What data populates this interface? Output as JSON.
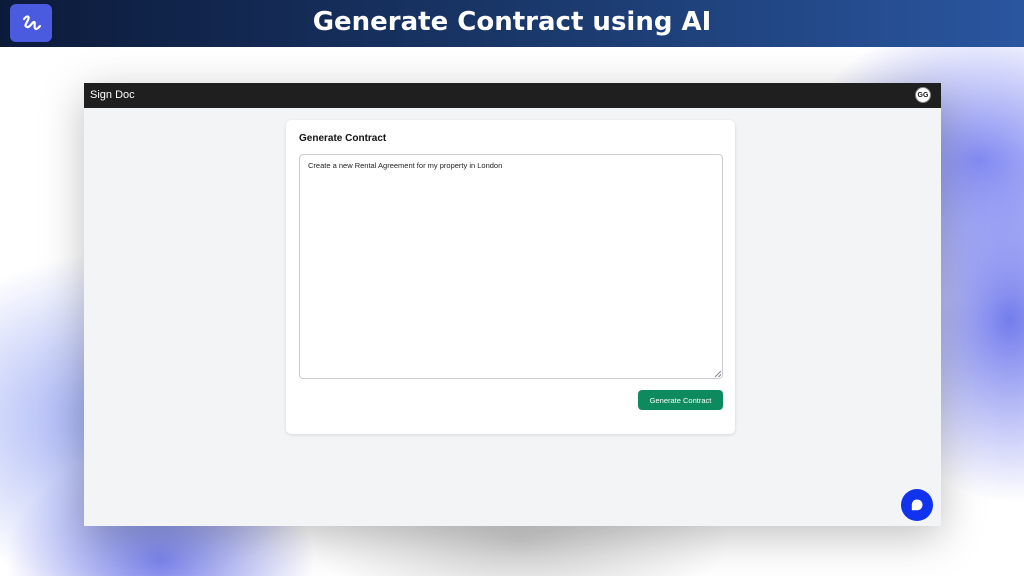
{
  "banner": {
    "title": "Generate Contract using AI",
    "logo_icon": "signature-icon"
  },
  "app": {
    "name": "Sign Doc",
    "avatar_initials": "GG"
  },
  "card": {
    "title": "Generate Contract",
    "prompt_value": "Create a new Rental Agreement for my property in London",
    "button_label": "Generate Contract"
  },
  "chat_widget": {
    "icon": "chat-bubble-icon"
  },
  "colors": {
    "banner_dark": "#0c1a3a",
    "logo_bg": "#4a5be0",
    "appbar": "#1f1f1f",
    "button": "#0e8a5f",
    "chat": "#1133ee",
    "page_bg": "#f3f4f6"
  }
}
